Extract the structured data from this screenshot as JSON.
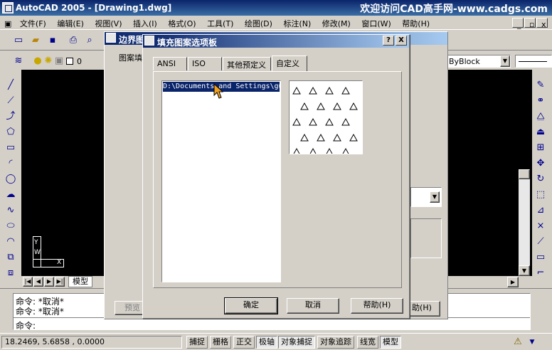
{
  "app": {
    "title": "AutoCAD 2005 - [Drawing1.dwg]",
    "watermark": "欢迎访问CAD高手网-www.cadgs.com"
  },
  "menu": [
    "文件(F)",
    "编辑(E)",
    "视图(V)",
    "插入(I)",
    "格式(O)",
    "工具(T)",
    "绘图(D)",
    "标注(N)",
    "修改(M)",
    "窗口(W)",
    "帮助(H)"
  ],
  "toolbar": {
    "layer_value": "0",
    "linetype_value": "ByBlock"
  },
  "boundary_dialog": {
    "title": "边界图",
    "tab_label": "图案填",
    "preview_label": "预览",
    "help_label": "助(H)"
  },
  "palette_dialog": {
    "title": "填充图案选项板",
    "help_caption": "?",
    "close_caption": "X",
    "tabs": [
      "ANSI",
      "ISO",
      "其他预定义",
      "自定义"
    ],
    "active_tab": "自定义",
    "list_item": "D:\\Documents and Settings\\gu",
    "ok": "确定",
    "cancel": "取消",
    "help": "帮助(H)"
  },
  "model_tab": "模型",
  "command_lines": [
    "命令: *取消*",
    "命令: *取消*",
    "命令:"
  ],
  "coords": "18.2469,  5.6858 , 0.0000",
  "status_buttons": [
    "捕捉",
    "栅格",
    "正交",
    "极轴",
    "对象捕捉",
    "对象追踪",
    "线宽",
    "模型"
  ],
  "colors": {
    "title_blue": "#0a246a",
    "selection": "#0a246a",
    "canvas": "#000000"
  }
}
